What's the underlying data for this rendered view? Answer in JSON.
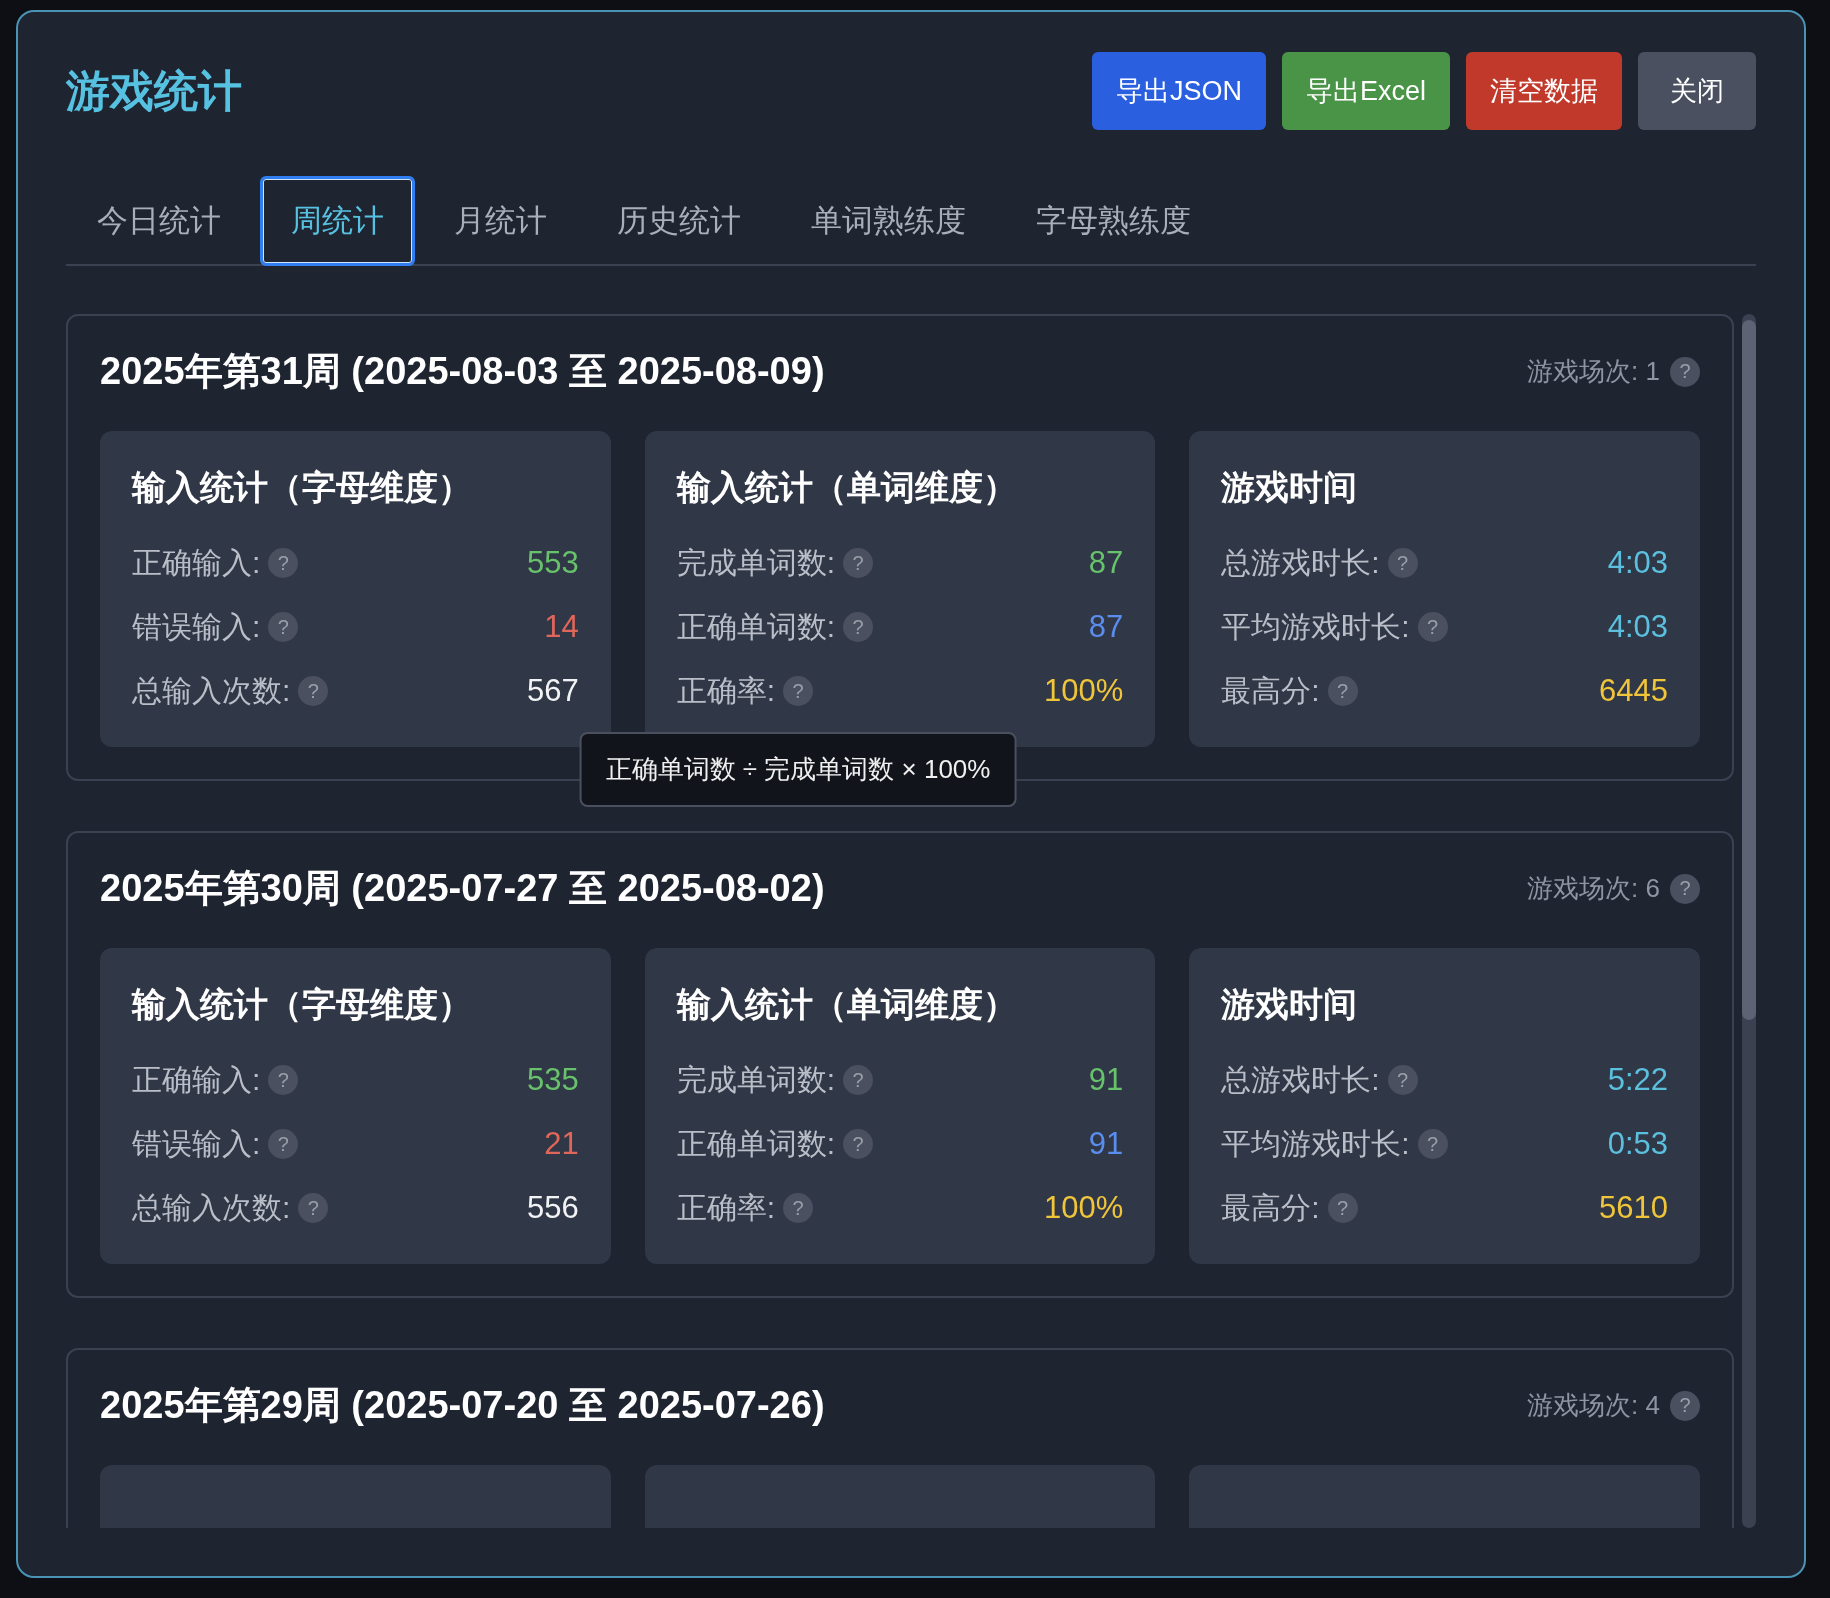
{
  "title": "游戏统计",
  "buttons": [
    {
      "label": "导出JSON",
      "kind": "primary"
    },
    {
      "label": "导出Excel",
      "kind": "success"
    },
    {
      "label": "清空数据",
      "kind": "danger"
    },
    {
      "label": "关闭",
      "kind": "neutral"
    }
  ],
  "tabs": [
    {
      "label": "今日统计",
      "selected": false
    },
    {
      "label": "周统计",
      "selected": true
    },
    {
      "label": "月统计",
      "selected": false
    },
    {
      "label": "历史统计",
      "selected": false
    },
    {
      "label": "单词熟练度",
      "selected": false
    },
    {
      "label": "字母熟练度",
      "selected": false
    }
  ],
  "weeks": [
    {
      "title": "2025年第31周 (2025-08-03 至 2025-08-09)",
      "count": "游戏场次: 1",
      "hint": "?",
      "groups": [
        {
          "title": "输入统计（字母维度）",
          "rows": [
            {
              "label": "正确输入:",
              "hint": "?",
              "value": "553",
              "color": "#67c26b"
            },
            {
              "label": "错误输入:",
              "hint": "?",
              "value": "14",
              "color": "#e0665a"
            },
            {
              "label": "总输入次数:",
              "hint": "?",
              "value": "567",
              "color": "#f2f3f5"
            }
          ]
        },
        {
          "title": "输入统计（单词维度）",
          "rows": [
            {
              "label": "完成单词数:",
              "hint": "?",
              "value": "87",
              "color": "#67c26b"
            },
            {
              "label": "正确单词数:",
              "hint": "?",
              "value": "87",
              "color": "#5b8def"
            },
            {
              "label": "正确率:",
              "hint": "?",
              "value": "100%",
              "color": "#f0c53a",
              "tooltip": "正确单词数 ÷ 完成单词数 × 100%"
            }
          ]
        },
        {
          "title": "游戏时间",
          "rows": [
            {
              "label": "总游戏时长:",
              "hint": "?",
              "value": "4:03",
              "color": "#5bc0de"
            },
            {
              "label": "平均游戏时长:",
              "hint": "?",
              "value": "4:03",
              "color": "#5bc0de"
            },
            {
              "label": "最高分:",
              "hint": "?",
              "value": "6445",
              "color": "#f0c53a"
            }
          ]
        }
      ]
    },
    {
      "title": "2025年第30周 (2025-07-27 至 2025-08-02)",
      "count": "游戏场次: 6",
      "hint": "?",
      "groups": [
        {
          "title": "输入统计（字母维度）",
          "rows": [
            {
              "label": "正确输入:",
              "hint": "?",
              "value": "535",
              "color": "#67c26b"
            },
            {
              "label": "错误输入:",
              "hint": "?",
              "value": "21",
              "color": "#e0665a"
            },
            {
              "label": "总输入次数:",
              "hint": "?",
              "value": "556",
              "color": "#f2f3f5"
            }
          ]
        },
        {
          "title": "输入统计（单词维度）",
          "rows": [
            {
              "label": "完成单词数:",
              "hint": "?",
              "value": "91",
              "color": "#67c26b"
            },
            {
              "label": "正确单词数:",
              "hint": "?",
              "value": "91",
              "color": "#5b8def"
            },
            {
              "label": "正确率:",
              "hint": "?",
              "value": "100%",
              "color": "#f0c53a"
            }
          ]
        },
        {
          "title": "游戏时间",
          "rows": [
            {
              "label": "总游戏时长:",
              "hint": "?",
              "value": "5:22",
              "color": "#5bc0de"
            },
            {
              "label": "平均游戏时长:",
              "hint": "?",
              "value": "0:53",
              "color": "#5bc0de"
            },
            {
              "label": "最高分:",
              "hint": "?",
              "value": "5610",
              "color": "#f0c53a"
            }
          ]
        }
      ]
    },
    {
      "title": "2025年第29周 (2025-07-20 至 2025-07-26)",
      "count": "游戏场次: 4",
      "hint": "?",
      "groups": [
        {
          "kind": "clipped"
        },
        {
          "kind": "clipped"
        },
        {
          "kind": "clipped"
        }
      ]
    }
  ]
}
